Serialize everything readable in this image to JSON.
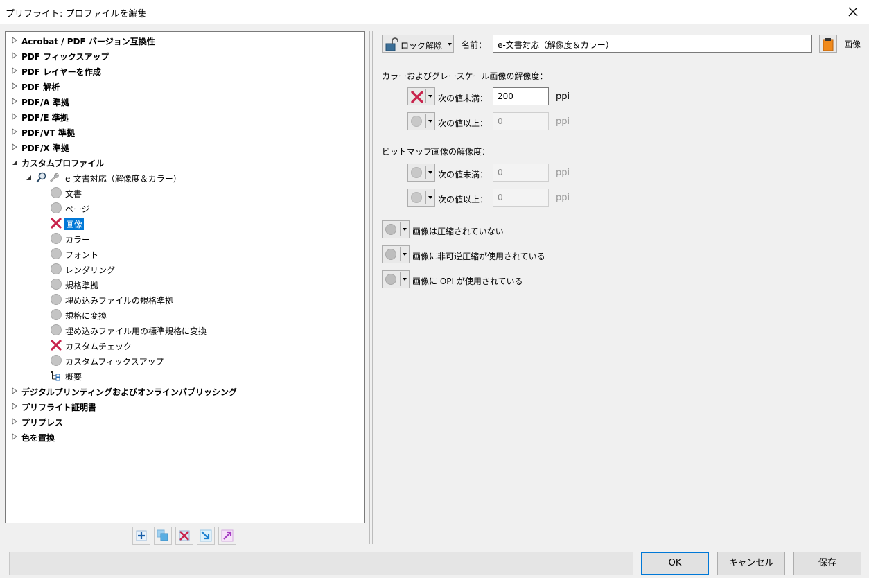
{
  "window": {
    "title": "プリフライト: プロファイルを編集"
  },
  "tree": {
    "items": [
      {
        "label": "Acrobat / PDF バージョン互換性"
      },
      {
        "label": "PDF フィックスアップ"
      },
      {
        "label": "PDF レイヤーを作成"
      },
      {
        "label": "PDF 解析"
      },
      {
        "label": "PDF/A 準拠"
      },
      {
        "label": "PDF/E 準拠"
      },
      {
        "label": "PDF/VT 準拠"
      },
      {
        "label": "PDF/X 準拠"
      },
      {
        "label": "カスタムプロファイル"
      },
      {
        "label": "e-文書対応（解像度＆カラー）"
      },
      {
        "label": "文書"
      },
      {
        "label": "ページ"
      },
      {
        "label": "画像"
      },
      {
        "label": "カラー"
      },
      {
        "label": "フォント"
      },
      {
        "label": "レンダリング"
      },
      {
        "label": "規格準拠"
      },
      {
        "label": "埋め込みファイルの規格準拠"
      },
      {
        "label": "規格に変換"
      },
      {
        "label": "埋め込みファイル用の標準規格に変換"
      },
      {
        "label": "カスタムチェック"
      },
      {
        "label": "カスタムフィックスアップ"
      },
      {
        "label": "概要"
      },
      {
        "label": "デジタルプリンティングおよびオンラインパブリッシング"
      },
      {
        "label": "プリフライト証明書"
      },
      {
        "label": "プリプレス"
      },
      {
        "label": "色を置換"
      }
    ]
  },
  "right": {
    "lock_button": "ロック解除",
    "name_label": "名前：",
    "name_value": "e-文書対応（解像度＆カラー）",
    "section_tag": "画像",
    "color_res_heading": "カラーおよびグレースケール画像の解像度：",
    "below_label": "次の値未満：",
    "above_label": "次の値以上：",
    "color_below_value": "200",
    "color_above_value": "0",
    "unit": "ppi",
    "bitmap_res_heading": "ビットマップ画像の解像度：",
    "bitmap_below_value": "0",
    "bitmap_above_value": "0",
    "check_uncompressed": "画像は圧縮されていない",
    "check_lossy": "画像に非可逆圧縮が使用されている",
    "check_opi": "画像に OPI が使用されている"
  },
  "footer": {
    "ok": "OK",
    "cancel": "キャンセル",
    "save": "保存"
  },
  "colors": {
    "selection": "#0078d7",
    "error": "#c8254d"
  }
}
